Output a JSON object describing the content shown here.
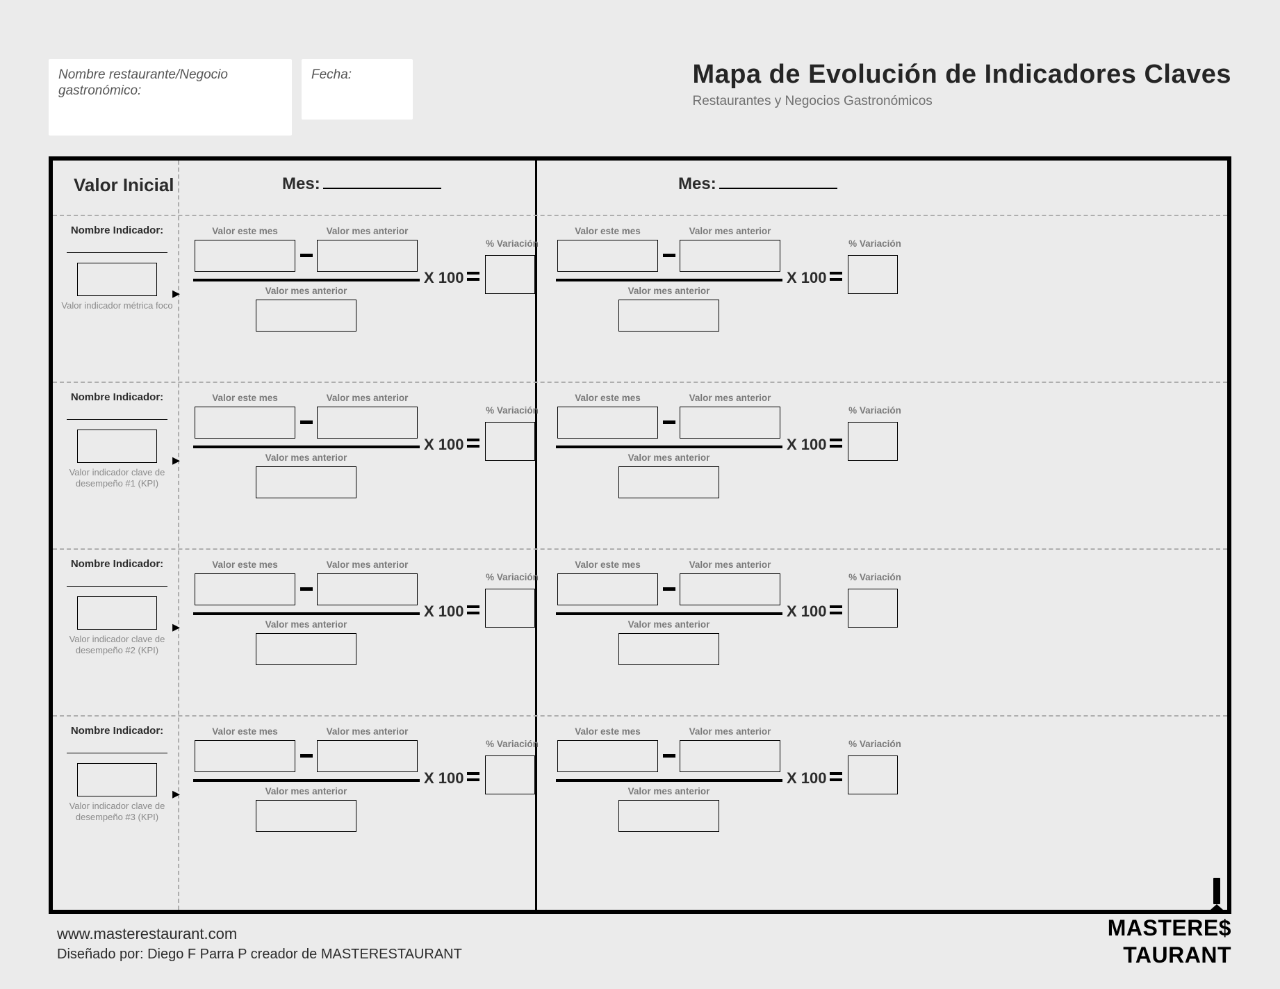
{
  "header": {
    "restaurant_label": "Nombre restaurante/Negocio gastronómico:",
    "date_label": "Fecha:",
    "title": "Mapa de Evolución de Indicadores Claves",
    "subtitle": "Restaurantes y Negocios Gastronómicos"
  },
  "cols": {
    "valor_inicial": "Valor Inicial",
    "mes_label": "Mes:"
  },
  "row_labels": {
    "nombre": "Nombre Indicador:",
    "captions": [
      "Valor indicador métrica foco",
      "Valor indicador clave de desempeño #1 (KPI)",
      "Valor indicador clave de desempeño #2 (KPI)",
      "Valor indicador clave de desempeño #3 (KPI)"
    ]
  },
  "formula": {
    "este_mes": "Valor este mes",
    "mes_anterior": "Valor mes anterior",
    "denominador": "Valor mes anterior",
    "x100": "X 100",
    "variacion": "% Variación"
  },
  "footer": {
    "url": "www.masterestaurant.com",
    "credit": "Diseñado por: Diego F Parra P creador de MASTERESTAURANT",
    "logo_text": "MASTERESTAURANT"
  }
}
